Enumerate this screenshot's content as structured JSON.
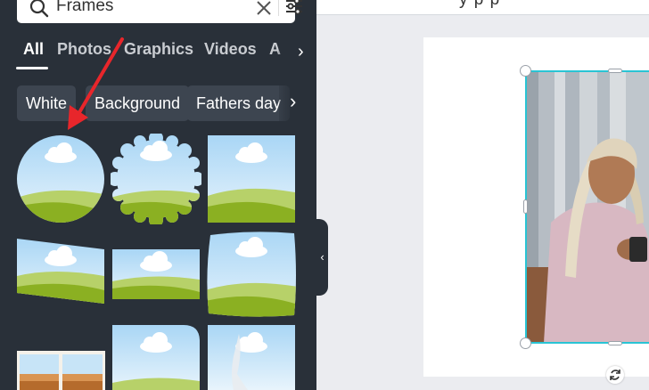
{
  "panel": {
    "search": {
      "value": "Frames",
      "placeholder": ""
    },
    "tabs": [
      {
        "label": "All",
        "active": true
      },
      {
        "label": "Photos",
        "active": false
      },
      {
        "label": "Graphics",
        "active": false
      },
      {
        "label": "Videos",
        "active": false
      },
      {
        "label": "A",
        "active": false
      }
    ],
    "chips": [
      "White",
      "Background",
      "Fathers day"
    ],
    "frames": [
      {
        "name": "circle-frame"
      },
      {
        "name": "scalloped-circle-frame"
      },
      {
        "name": "square-frame"
      },
      {
        "name": "slanted-frame"
      },
      {
        "name": "wide-rectangle-frame"
      },
      {
        "name": "rough-square-frame"
      },
      {
        "name": "polaroid-strip-frame"
      },
      {
        "name": "rounded-corner-frame"
      },
      {
        "name": "rocket-frame"
      }
    ]
  },
  "canvas": {
    "topbar_text": "y    p    p"
  },
  "colors": {
    "panel_bg": "#293039",
    "chip_bg": "#3d4550",
    "selection": "#29c4d4",
    "arrow": "#e8262b",
    "sky": "#c7e4f7",
    "grass": "#8bb022"
  },
  "icons": {
    "search": "search-icon",
    "clear": "close-icon",
    "filter": "sliders-icon",
    "tabs_more": "chevron-right-icon",
    "chips_more": "chevron-right-icon",
    "collapse": "chevron-left-icon",
    "rotate": "rotate-icon"
  }
}
